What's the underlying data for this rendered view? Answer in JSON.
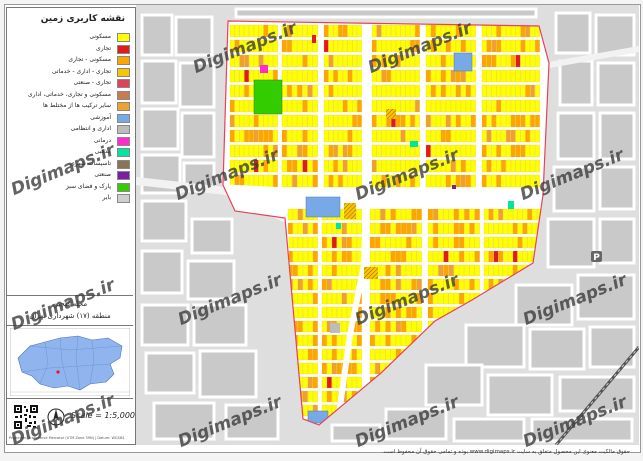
{
  "legend": {
    "title": "نقشه کاربری زمین",
    "items": [
      {
        "label": "مسکونی",
        "color": "#ffff00"
      },
      {
        "label": "تجاری",
        "color": "#e31a1c"
      },
      {
        "label": "مسکونی - تجاری",
        "color": "#ffa500"
      },
      {
        "label": "تجاری - اداری - خدماتی",
        "color": "#f7c600"
      },
      {
        "label": "تجاری - صنعتی",
        "color": "#e0425a"
      },
      {
        "label": "مسکونی و تجاری، خدماتی، اداری",
        "color": "#c87c50"
      },
      {
        "label": "سایر ترکیب ها از مختلط ها",
        "color": "#f0a030"
      },
      {
        "label": "آموزشی",
        "color": "#77a9e6"
      },
      {
        "label": "اداری و انتظامی",
        "color": "#bcbcbc"
      },
      {
        "label": "درمانی",
        "color": "#ff2bd0"
      },
      {
        "label": "مذهبی",
        "color": "#00e6a0"
      },
      {
        "label": "تاسیسات شهری",
        "color": "#8b7355"
      },
      {
        "label": "صنعتی",
        "color": "#7a1fa2"
      },
      {
        "label": "پارک و فضای سبز",
        "color": "#33cc00"
      },
      {
        "label": "بایر",
        "color": "#cfcfcf"
      }
    ],
    "neighbourhood": "محله گلچین",
    "district": "منطقه (۱۷) شهرداری تهران",
    "scale": "Scale = 1:5,000",
    "north": "N",
    "footer": "Projection: Transverse Mercator (UTM Zone 39N) | Datum: WGS84"
  },
  "watermark": "Digimaps.ir",
  "copyright": "حقوق مالکیت معنوی این محصول متعلق به سایت www.digimaps.ir بوده و تمامی حقوق آن محفوظ است.",
  "colors": {
    "residential": "#ffff00",
    "mixed": "#ffa500",
    "commercial": "#e31a1c",
    "education": "#77a9e6",
    "park": "#33cc00",
    "boundary": "#e8415a",
    "road": "#ffffff",
    "background": "#dcdcdc"
  }
}
